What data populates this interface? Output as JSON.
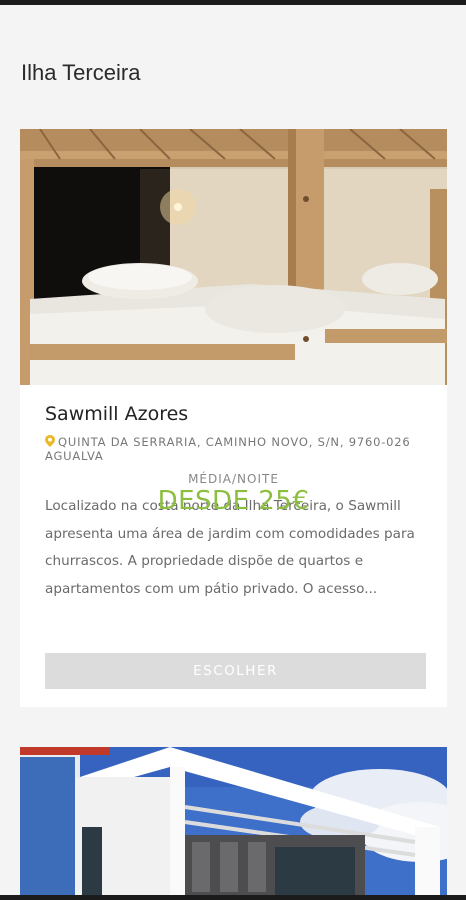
{
  "page": {
    "title": "Ilha Terceira"
  },
  "listings": [
    {
      "name": "Sawmill Azores",
      "address": "QUINTA DA SERRARIA, CAMINHO NOVO, S/N, 9760-026 AGUALVA",
      "description": "Localizado na costa norte da Ilha Terceira, o Sawmill apresenta uma área de jardim com comodidades para churrascos. A propriedade dispõe de quartos e apartamentos com um pátio privado. O acesso...",
      "price_caption": "MÉDIA/NOITE",
      "price": "DESDE 25€",
      "button_label": "ESCOLHER",
      "icon": "map-pin-icon"
    }
  ],
  "colors": {
    "accent_green": "#8cbf3f",
    "pin_yellow": "#e9b92a",
    "button_disabled": "#dcdcdc",
    "background": "#f4f4f4"
  }
}
